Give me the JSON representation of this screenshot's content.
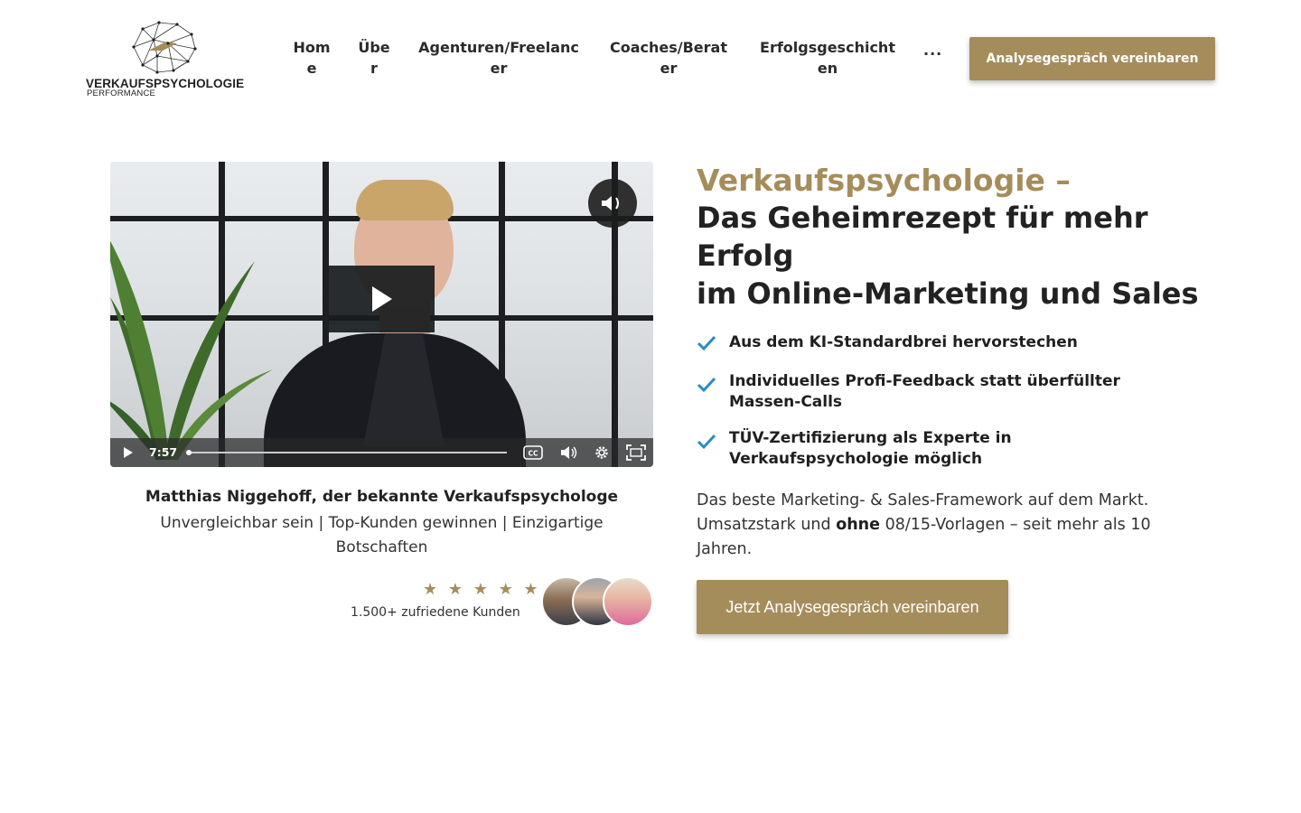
{
  "header": {
    "logo": {
      "wordmark": "VERKAUFSPSYCHOLOGIE",
      "sub": "PERFORMANCE"
    },
    "nav": [
      {
        "label": "Home"
      },
      {
        "label": "Über"
      },
      {
        "label": "Agenturen/Freelancer"
      },
      {
        "label": "Coaches/Berater"
      },
      {
        "label": "Erfolgsgeschichten"
      }
    ],
    "more_label": "···",
    "cta_label": "Analysegespräch vereinbaren"
  },
  "video": {
    "duration": "7:57",
    "progress": 0.0,
    "controls": [
      "play-icon",
      "closed-captions-icon",
      "volume-icon",
      "settings-icon",
      "fullscreen-icon"
    ]
  },
  "speaker": {
    "name": "Matthias Niggehoff, der bekannte Verkaufspsychologe",
    "tagline": "Unvergleichbar sein | Top-Kunden gewinnen | Einzigartige Botschaften"
  },
  "social_proof": {
    "stars": "★ ★ ★ ★ ★",
    "rating": 5,
    "customers": "1.500+ zufriedene Kunden"
  },
  "hero": {
    "accent": "Verkaufspsychologie –",
    "headline_1": "Das Geheimrezept für mehr Erfolg",
    "headline_2": "im Online-Marketing und Sales",
    "benefits": [
      "Aus dem KI-Standardbrei hervorstechen",
      "Individuelles Profi-Feedback statt überfüllter Massen-Calls",
      "TÜV-Zertifizierung als Experte in Verkaufspsychologie möglich"
    ],
    "desc_1": "Das beste Marketing- & Sales-Framework auf dem Markt. Umsatzstark und ",
    "desc_bold": "ohne",
    "desc_2": " 08/15-Vorlagen – seit mehr als 10 Jahren.",
    "cta_label": "Jetzt Analysegespräch vereinbaren"
  },
  "colors": {
    "accent": "#a58d5b",
    "check": "#2a8ac4",
    "text": "#1f1f1f"
  }
}
